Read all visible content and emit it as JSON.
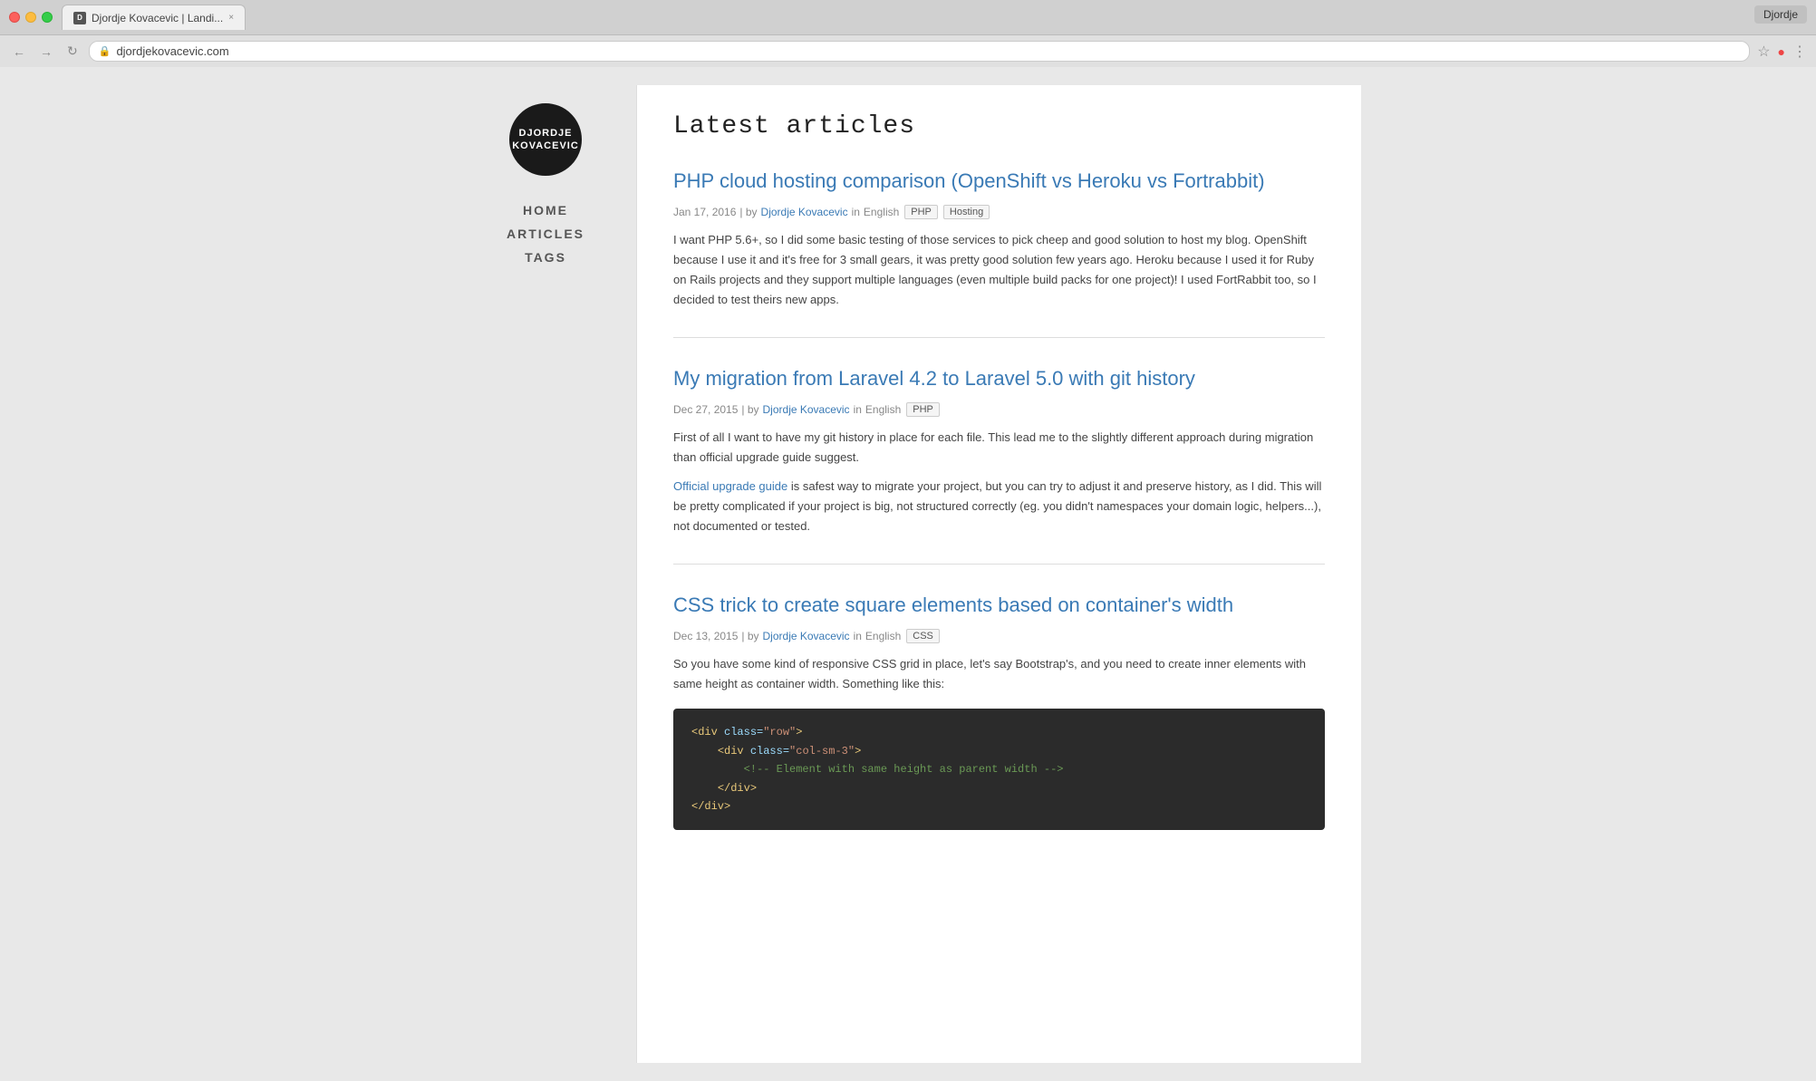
{
  "browser": {
    "tab_favicon": "D",
    "tab_label": "Djordje Kovacevic | Landi...",
    "tab_close": "×",
    "profile_label": "Djordje",
    "nav_back": "←",
    "nav_forward": "→",
    "nav_refresh": "↻",
    "address_url": "djordjekovacevic.com",
    "bookmark_icon": "☆",
    "extensions_icon": "●",
    "menu_icon": "⋮"
  },
  "sidebar": {
    "logo_line1": "DJORDJE",
    "logo_line2": "KOVACEVIC",
    "nav_items": [
      {
        "label": "HOME",
        "id": "home"
      },
      {
        "label": "ARTICLES",
        "id": "articles"
      },
      {
        "label": "TAGS",
        "id": "tags"
      }
    ]
  },
  "main": {
    "page_title": "Latest articles",
    "articles": [
      {
        "id": "article-1",
        "title": "PHP cloud hosting comparison (OpenShift vs Heroku vs Fortrabbit)",
        "date": "Jan 17, 2016",
        "author": "Djordje Kovacevic",
        "language": "English",
        "tags": [
          "PHP",
          "Hosting"
        ],
        "excerpt": "I want PHP 5.6+, so I did some basic testing of those services to pick cheep and good solution to host my blog. OpenShift because I use it and it's free for 3 small gears, it was pretty good solution few years ago. Heroku because I used it for Ruby on Rails projects and they support multiple languages (even multiple build packs for one project)! I used FortRabbit too, so I decided to test theirs new apps."
      },
      {
        "id": "article-2",
        "title": "My migration from Laravel 4.2 to Laravel 5.0 with git history",
        "date": "Dec 27, 2015",
        "author": "Djordje Kovacevic",
        "language": "English",
        "tags": [
          "PHP"
        ],
        "excerpt_parts": [
          {
            "text": "First of all I want to have my git history in place for each file. This lead me to the slightly different approach during migration than official upgrade guide suggest.",
            "link": false
          },
          {
            "text": "Official upgrade guide",
            "link": true
          },
          {
            "text": " is safest way to migrate your project, but you can try to adjust it and preserve history, as I did. This will be pretty complicated if your project is big, not structured correctly (eg. you didn't namespaces your domain logic, helpers...), not documented or tested.",
            "link": false
          }
        ]
      },
      {
        "id": "article-3",
        "title": "CSS trick to create square elements based on container's width",
        "date": "Dec 13, 2015",
        "author": "Djordje Kovacevic",
        "language": "English",
        "tags": [
          "CSS"
        ],
        "excerpt": "So you have some kind of responsive CSS grid in place, let's say Bootstrap's, and you need to create inner elements with same height as container width. Something like this:",
        "code": [
          {
            "indent": 0,
            "content": "<div class=\"row\">",
            "type": "tag"
          },
          {
            "indent": 1,
            "content": "<div class=\"col-sm-3\">",
            "type": "tag"
          },
          {
            "indent": 2,
            "content": "<!-- Element with same height as parent width -->",
            "type": "comment"
          },
          {
            "indent": 1,
            "content": "</div>",
            "type": "tag"
          },
          {
            "indent": 0,
            "content": "</div>",
            "type": "tag"
          }
        ]
      }
    ]
  }
}
